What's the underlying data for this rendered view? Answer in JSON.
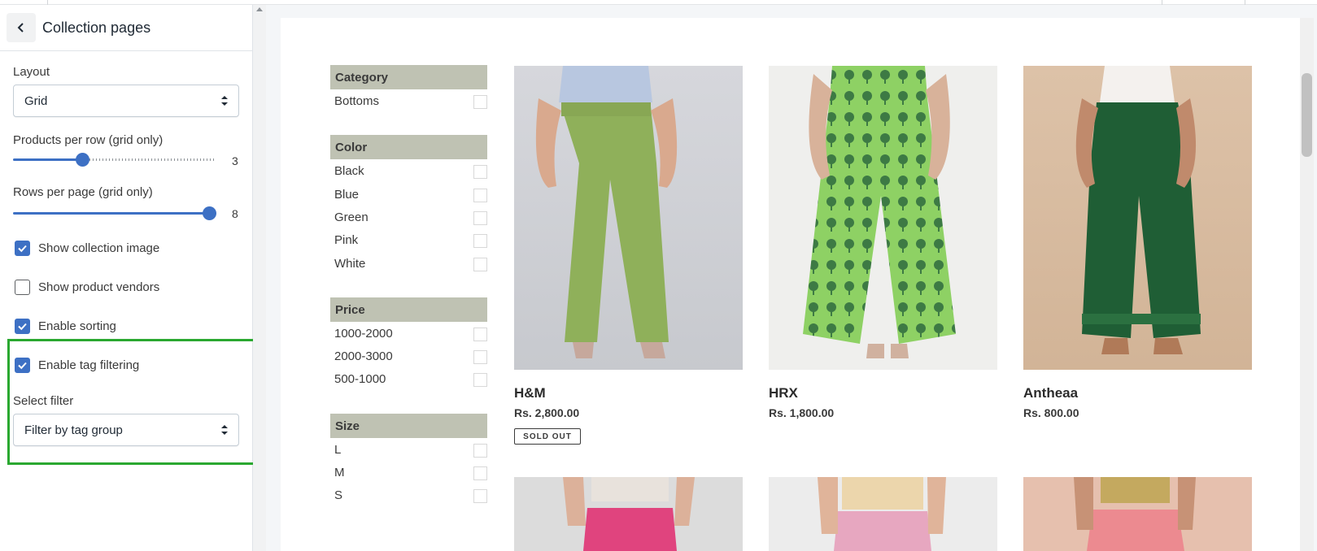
{
  "sidebar": {
    "title": "Collection pages",
    "layout": {
      "label": "Layout",
      "value": "Grid"
    },
    "products_per_row": {
      "label": "Products per row (grid only)",
      "value": "3",
      "fraction": 0.33
    },
    "rows_per_page": {
      "label": "Rows per page (grid only)",
      "value": "8",
      "fraction": 1.0
    },
    "checkboxes": [
      {
        "label": "Show collection image",
        "checked": true
      },
      {
        "label": "Show product vendors",
        "checked": false
      },
      {
        "label": "Enable sorting",
        "checked": true
      },
      {
        "label": "Enable tag filtering",
        "checked": true
      }
    ],
    "select_filter": {
      "label": "Select filter",
      "value": "Filter by tag group"
    }
  },
  "filters": [
    {
      "heading": "Category",
      "options": [
        "Bottoms"
      ]
    },
    {
      "heading": "Color",
      "options": [
        "Black",
        "Blue",
        "Green",
        "Pink",
        "White"
      ]
    },
    {
      "heading": "Price",
      "options": [
        "1000-2000",
        "2000-3000",
        "500-1000"
      ]
    },
    {
      "heading": "Size",
      "options": [
        "L",
        "M",
        "S"
      ]
    }
  ],
  "products": [
    {
      "name": "H&M",
      "price": "Rs. 2,800.00",
      "badge": "SOLD OUT"
    },
    {
      "name": "HRX",
      "price": "Rs. 1,800.00"
    },
    {
      "name": "Antheaa",
      "price": "Rs. 800.00"
    }
  ],
  "colors": {
    "accent": "#3d70c4",
    "highlight": "#2aa830",
    "filter_header": "#bfc2b3"
  }
}
